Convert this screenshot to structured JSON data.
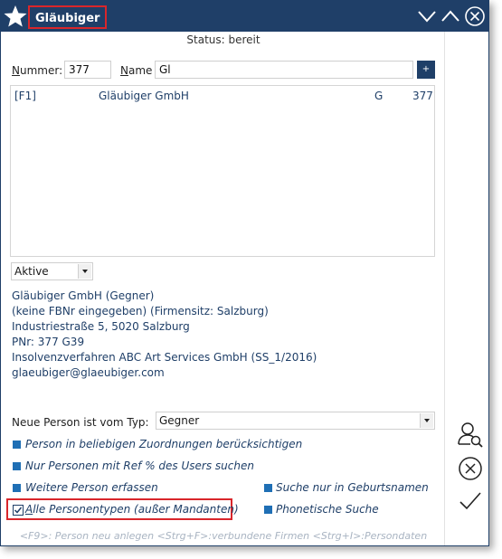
{
  "window": {
    "title": "Gläubiger",
    "status": "Status: bereit"
  },
  "titlebar_buttons": [
    "chevron-down-icon",
    "chevron-up-icon",
    "close-circle-icon"
  ],
  "search": {
    "nummer_label_prefix": "N",
    "nummer_label_rest": "ummer:",
    "nummer_value": "377",
    "name_label_prefix": "N",
    "name_label_rest": "ame",
    "name_value": "Gl",
    "plus_label": "+"
  },
  "results": [
    {
      "key": "[F1]",
      "name": "Gläubiger GmbH",
      "type": "G",
      "number": "377"
    }
  ],
  "filter": {
    "selected": "Aktive"
  },
  "details": {
    "lines": [
      "Gläubiger GmbH (Gegner)",
      "(keine FBNr eingegeben) (Firmensitz: Salzburg)",
      "Industriestraße 5, 5020 Salzburg",
      "PNr: 377 G39",
      "Insolvenzverfahren ABC Art Services GmbH (SS_1/2016)",
      "glaeubiger@glaeubiger.com"
    ]
  },
  "neue_person": {
    "label": "Neue Person ist vom Typ:",
    "selected": "Gegner"
  },
  "options": {
    "opt1": "Person in beliebigen Zuordnungen berücksichtigen",
    "opt2": "Nur Personen mit Ref % des Users suchen",
    "opt3": "Weitere Person erfassen",
    "opt4": "Suche nur in Geburtsnamen",
    "opt5_prefix": "A",
    "opt5_rest": "lle Personentypen (außer Mandanten)",
    "opt6": "Phonetische Suche"
  },
  "footer": "<F9>: Person neu anlegen <Strg+F>:verbundene Firmen <Strg+I>:Persondaten",
  "colors": {
    "titlebar": "#1f3f68",
    "accent": "#1f6fb5",
    "highlight": "#d9262b"
  }
}
